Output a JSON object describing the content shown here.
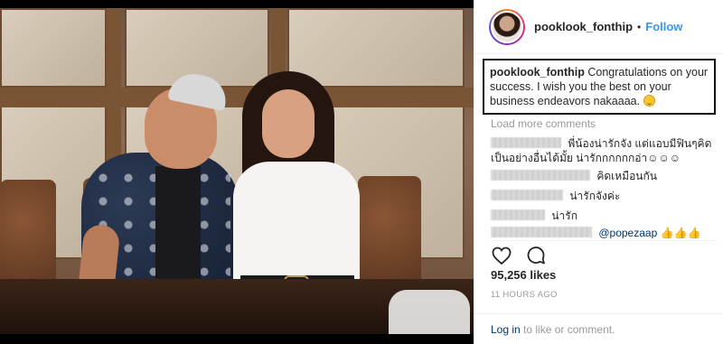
{
  "post": {
    "username": "pooklook_fonthip",
    "separator": "•",
    "follow_label": "Follow",
    "caption": {
      "username": "pooklook_fonthip",
      "text": "Congratulations on your success. I wish you the best on your business endeavors nakaaaa."
    },
    "load_more_label": "Load more comments",
    "comments": [
      {
        "text_line1": "พี่น้องน่ารักจัง แต่แอบมีฟินๆคิด",
        "text_line2": "เป็นอย่างอื่นได้มั้ย น่ารักกกกกกอ่า☺☺☺"
      },
      {
        "text": "คิดเหมือนกัน"
      },
      {
        "text": "น่ารักจังค่ะ"
      },
      {
        "text": "น่ารัก"
      },
      {
        "mention": "@popezaap",
        "emoji": "👍👍👍"
      }
    ],
    "likes_text": "95,256 likes",
    "time_text": "11 HOURS AGO",
    "footer": {
      "login_label": "Log in",
      "suffix": " to like or comment."
    }
  },
  "icons": {
    "like": "heart-icon",
    "comment": "comment-icon",
    "emoji": "smile-icon"
  },
  "colors": {
    "link": "#3897f0",
    "accent_dark": "#003569",
    "muted": "#999999"
  }
}
